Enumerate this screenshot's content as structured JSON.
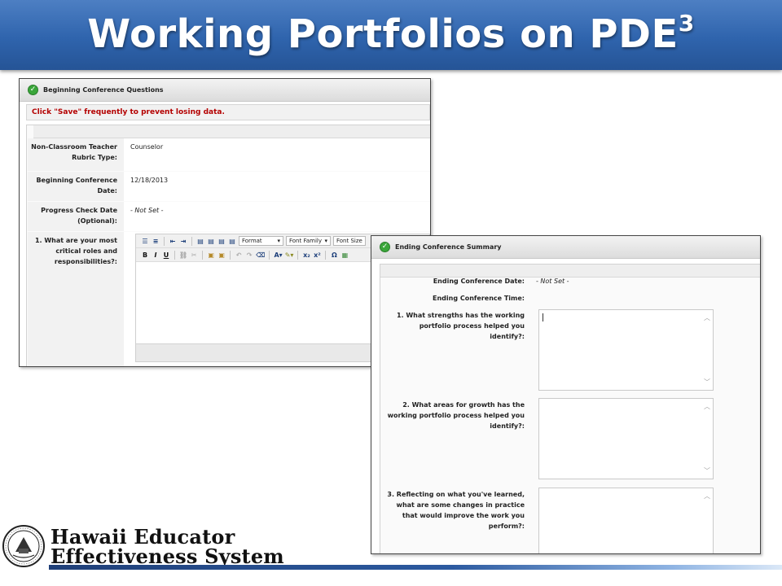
{
  "slide": {
    "title": "Working Portfolios on PDE",
    "title_superscript": "3"
  },
  "colors": {
    "banner": "#2f64ad",
    "warning_text": "#b40000",
    "check_icon": "#3aa63a"
  },
  "beginning_panel": {
    "header": "Beginning Conference Questions",
    "warning": "Click \"Save\" frequently to prevent losing data.",
    "fields": [
      {
        "label": "Non-Classroom Teacher Rubric Type:",
        "value": "Counselor"
      },
      {
        "label": "Beginning Conference Date:",
        "value": "12/18/2013"
      },
      {
        "label": "Progress Check Date (Optional):",
        "value": "- Not Set -"
      },
      {
        "label": "1. What are your most critical roles and responsibilities?:",
        "value": ""
      }
    ],
    "editor": {
      "format_select": "Format",
      "font_family_select": "Font Family",
      "font_size_select": "Font Size",
      "bold_label": "B",
      "italic_label": "I",
      "underline_label": "U",
      "omega_label": "Ω"
    }
  },
  "ending_panel": {
    "header": "Ending Conference Summary",
    "fields": [
      {
        "label": "Ending Conference Date:",
        "value": "- Not Set -"
      },
      {
        "label": "Ending Conference Time:",
        "value": ""
      },
      {
        "label": "1. What strengths has the working portfolio process helped you identify?:",
        "value": ""
      },
      {
        "label": "2. What areas for growth has the working portfolio process helped you identify?:",
        "value": ""
      },
      {
        "label": "3. Reflecting on what you've learned, what are some changes in practice that would improve the work you perform?:",
        "value": ""
      }
    ]
  },
  "logo": {
    "line1": "Hawaii Educator",
    "line2": "Effectiveness System",
    "seal_icon": "state-department-of-education-seal-icon"
  }
}
